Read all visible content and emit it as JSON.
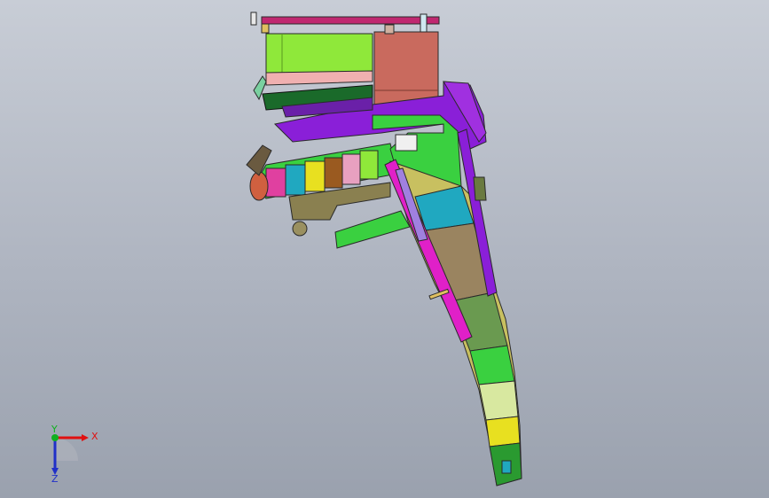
{
  "viewport": {
    "background_top": "#c8cdd6",
    "background_bottom": "#9aa1ae"
  },
  "triad": {
    "x_label": "X",
    "y_label": "Y",
    "z_label": "Z",
    "x_color": "#e01010",
    "y_color": "#10b020",
    "z_color": "#2030c8"
  },
  "model": {
    "name_icon": "cad-assembly-icon",
    "palette": {
      "lime": "#8fe83a",
      "salmon": "#c96a5e",
      "purple": "#8a1fd8",
      "magenta": "#e020c8",
      "cyan": "#20a8c0",
      "tan": "#9a8460",
      "olive": "#8a8050",
      "green": "#3ad040",
      "yellow": "#e8e020",
      "pink": "#d0508a",
      "dark": "#2a2a2a"
    }
  }
}
